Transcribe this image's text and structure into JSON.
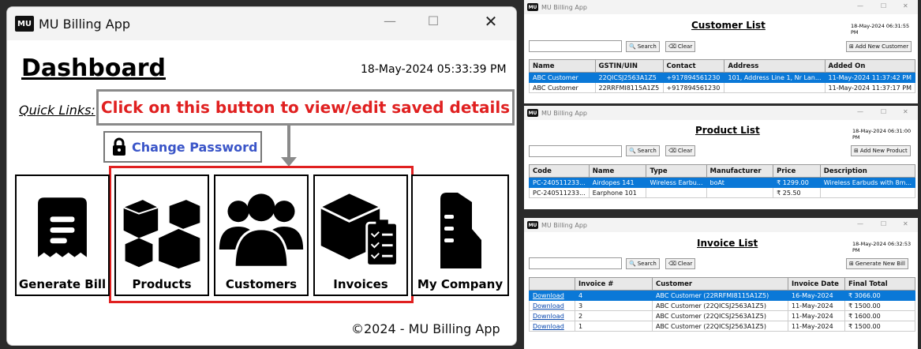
{
  "main": {
    "title": "MU Billing App",
    "logo": "MU",
    "heading": "Dashboard",
    "datetime": "18-May-2024 05:33:39 PM",
    "quick_links": "Quick Links:",
    "callout": "Click on this button to view/edit saved details",
    "change_password": "Change Password",
    "footer": "©2024 - MU Billing App",
    "tiles": [
      "Generate Bill",
      "Products",
      "Customers",
      "Invoices",
      "My Company"
    ]
  },
  "customer_window": {
    "title": "MU Billing App",
    "heading": "Customer List",
    "datetime": "18-May-2024 06:31:55 PM",
    "search": "Search",
    "clear": "Clear",
    "add": "Add New Customer",
    "columns": [
      "Name",
      "GSTIN/UIN",
      "Contact",
      "Address",
      "Added On"
    ],
    "rows": [
      [
        "ABC Customer",
        "22QICSJ2563A1Z5",
        "+917894561230",
        "101, Address Line 1, Nr Lan...",
        "11-May-2024 11:37:42 PM"
      ],
      [
        "ABC Customer",
        "22RRFMI8115A1Z5",
        "+917894561230",
        "",
        "11-May-2024 11:37:17 PM"
      ]
    ]
  },
  "product_window": {
    "title": "MU Billing App",
    "heading": "Product List",
    "datetime": "18-May-2024 06:31:00 PM",
    "search": "Search",
    "clear": "Clear",
    "add": "Add New Product",
    "columns": [
      "Code",
      "Name",
      "Type",
      "Manufacturer",
      "Price",
      "Description"
    ],
    "rows": [
      [
        "PC-240511233...",
        "Airdopes 141",
        "Wireless Earbu...",
        "boAt",
        "₹ 1299.00",
        "Wireless Earbuds with 8m..."
      ],
      [
        "PC-240511233...",
        "Earphone 101",
        "",
        "",
        "₹ 25.50",
        ""
      ]
    ]
  },
  "invoice_window": {
    "title": "MU Billing App",
    "heading": "Invoice List",
    "datetime": "18-May-2024 06:32:53 PM",
    "search": "Search",
    "clear": "Clear",
    "add": "Generate New Bill",
    "columns": [
      "",
      "Invoice #",
      "Customer",
      "Invoice Date",
      "Final Total"
    ],
    "rows": [
      [
        "Download",
        "4",
        "ABC Customer (22RRFMI8115A1Z5)",
        "16-May-2024",
        "₹ 3066.00"
      ],
      [
        "Download",
        "3",
        "ABC Customer (22QICSJ2563A1Z5)",
        "11-May-2024",
        "₹ 1500.00"
      ],
      [
        "Download",
        "2",
        "ABC Customer (22QICSJ2563A1Z5)",
        "11-May-2024",
        "₹ 1600.00"
      ],
      [
        "Download",
        "1",
        "ABC Customer (22QICSJ2563A1Z5)",
        "11-May-2024",
        "₹ 1500.00"
      ]
    ]
  },
  "colors": {
    "accent_red": "#e02020",
    "link_blue": "#3a55c8",
    "selection": "#0a78d7"
  }
}
